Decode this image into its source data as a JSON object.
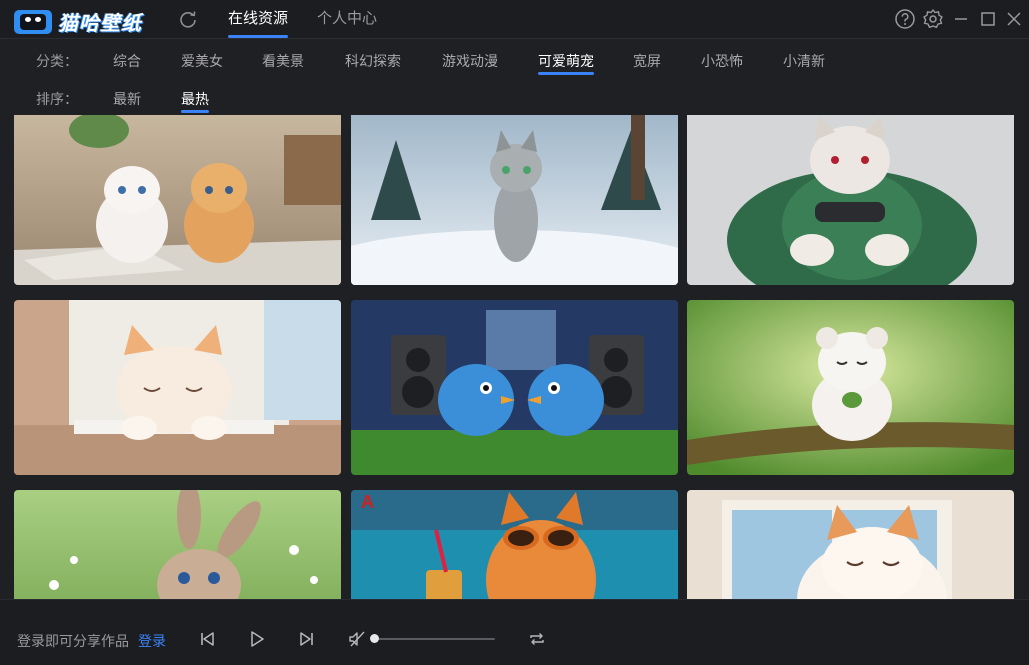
{
  "app": {
    "title": "猫哈壁纸"
  },
  "topnav": {
    "items": [
      {
        "label": "在线资源",
        "active": true
      },
      {
        "label": "个人中心",
        "active": false
      }
    ]
  },
  "filters": {
    "category": {
      "label": "分类：",
      "options": [
        "综合",
        "爱美女",
        "看美景",
        "科幻探索",
        "游戏动漫",
        "可爱萌宠",
        "宽屏",
        "小恐怖",
        "小清新"
      ],
      "selected": "可爱萌宠"
    },
    "sort": {
      "label": "排序：",
      "options": [
        "最新",
        "最热"
      ],
      "selected": "最热"
    }
  },
  "wallpapers": [
    {
      "subject": "white-and-orange-kittens-on-newspaper"
    },
    {
      "subject": "tabby-cat-walking-in-snow"
    },
    {
      "subject": "chubby-cat-with-game-controller"
    },
    {
      "subject": "sleepy-kitten-at-window"
    },
    {
      "subject": "blue-birds-with-speakers"
    },
    {
      "subject": "white-bear-cub-on-branch"
    },
    {
      "subject": "bunny-in-flower-meadow"
    },
    {
      "subject": "orange-cat-with-sunglasses-by-pool"
    },
    {
      "subject": "smiling-kitten-at-window"
    }
  ],
  "footer": {
    "login_hint": "登录即可分享作品",
    "login_link": "登录",
    "volume": 0.0
  },
  "colors": {
    "accent": "#3b82f6",
    "background": "#1f2024"
  }
}
